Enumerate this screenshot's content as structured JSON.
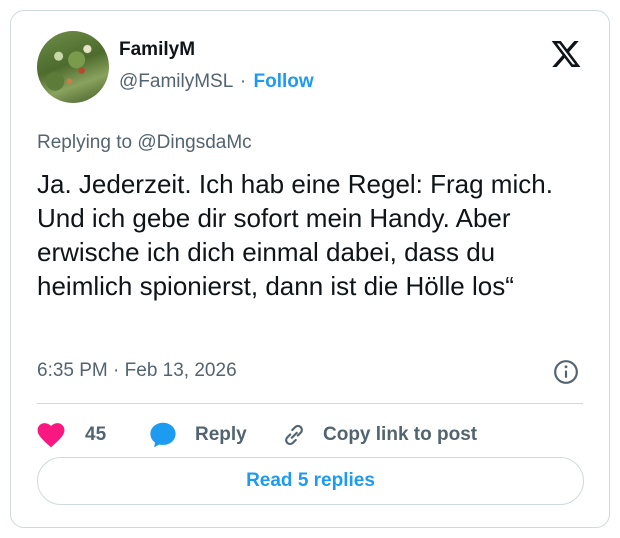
{
  "author": {
    "name": "FamilyM",
    "handle": "@FamilyMSL",
    "separator": "·",
    "follow_label": "Follow",
    "avatar_icon": "profile-photo-garden"
  },
  "platform_icon": "x-logo-icon",
  "reply_context": {
    "prefix": "Replying to",
    "mention": "@DingsdaMc"
  },
  "tweet": {
    "text": "Ja. Jederzeit. Ich hab eine Regel: Frag mich. Und ich gebe dir sofort mein Handy. Aber erwische ich dich einmal dabei, dass du heimlich spionierst, dann ist die Hölle los“",
    "time": "6:35 PM",
    "separator": "·",
    "date": "Feb 13, 2026"
  },
  "actions": {
    "like_count": "45",
    "reply_label": "Reply",
    "copy_label": "Copy link to post"
  },
  "read_replies_label": "Read 5 replies",
  "colors": {
    "accent": "#1d9bf0",
    "like": "#f91880",
    "text": "#0f1419",
    "secondary_text": "#536471",
    "border": "#cfd9de"
  }
}
